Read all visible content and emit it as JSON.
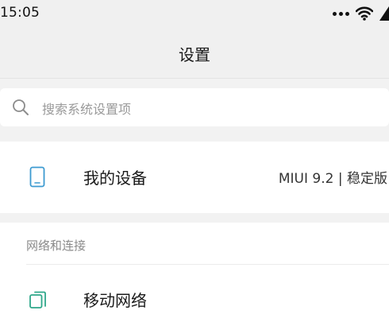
{
  "status_bar": {
    "time": "15:05",
    "icons": [
      "more-dots-icon",
      "wifi-icon",
      "signal-icon"
    ]
  },
  "header": {
    "title": "设置"
  },
  "search": {
    "placeholder": "搜索系统设置项",
    "icon": "search-icon"
  },
  "device": {
    "label": "我的设备",
    "version": "MIUI 9.2 | 稳定版",
    "icon": "phone-icon"
  },
  "network_section": {
    "title": "网络和连接",
    "items": [
      {
        "label": "移动网络",
        "icon": "sim-card-icon"
      }
    ]
  },
  "colors": {
    "accent": "#3d9bd1",
    "mobile_icon": "#2fa88a",
    "background": "#f2f2f2"
  }
}
